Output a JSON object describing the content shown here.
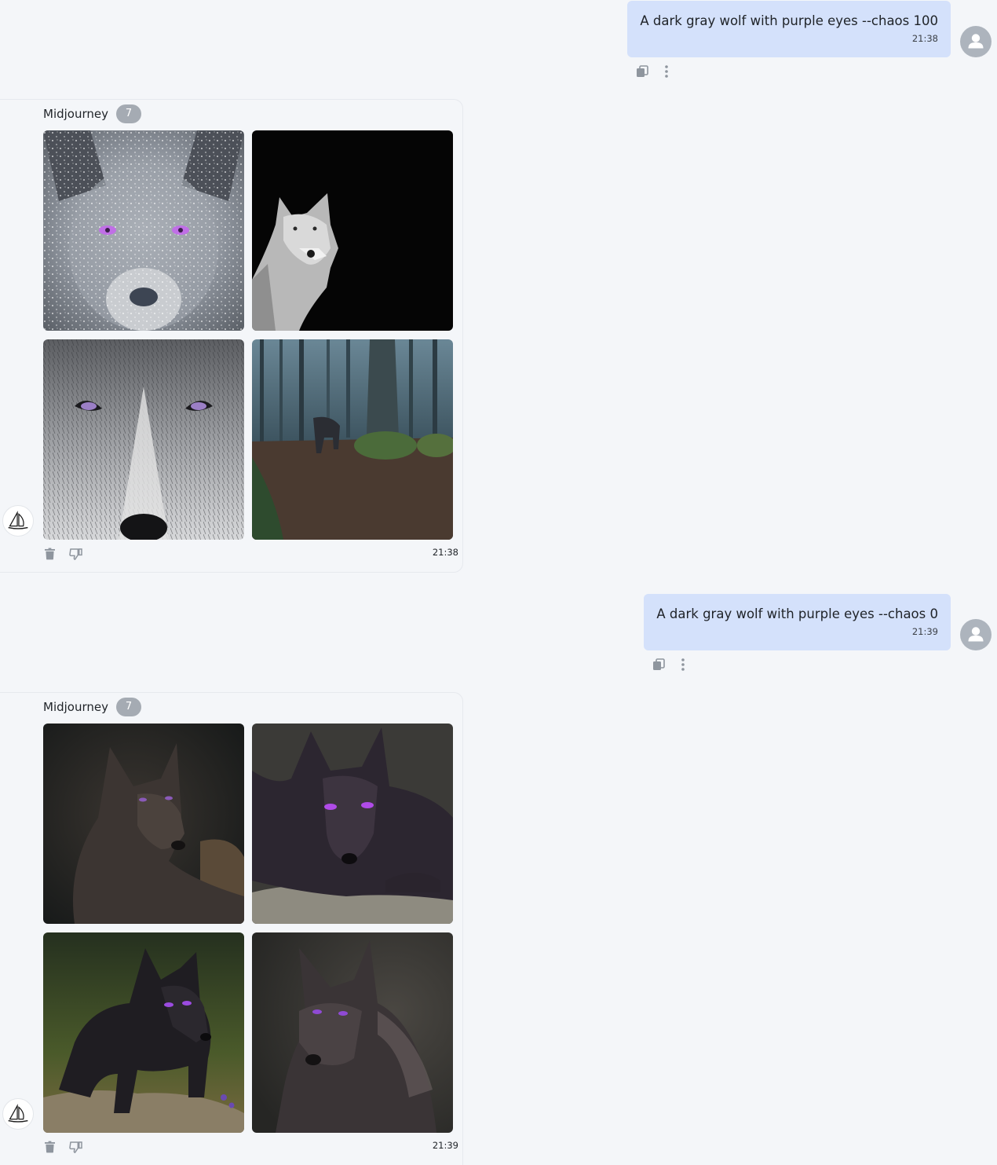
{
  "messages": [
    {
      "prompt": "A dark gray wolf with purple eyes --chaos 100",
      "time": "21:38"
    },
    {
      "bot_name": "Midjourney",
      "badge": "7",
      "time": "21:38",
      "images": [
        "wolf-face-snow-image",
        "white-wolf-black-bg-image",
        "wolf-closeup-gray-image",
        "wolf-in-forest-image"
      ]
    },
    {
      "prompt": "A dark gray wolf with purple eyes --chaos 0",
      "time": "21:39"
    },
    {
      "bot_name": "Midjourney",
      "badge": "7",
      "time": "21:39",
      "images": [
        "dark-wolf-lying-image",
        "black-wolf-rock-image",
        "dark-wolf-grass-image",
        "dark-wolf-portrait-image"
      ]
    }
  ],
  "colors": {
    "background": "#f4f6f9",
    "user_bubble": "#d4e1fb",
    "badge": "#a5abb3",
    "icon": "#8e959e",
    "purple_eye": "#b05de0"
  }
}
